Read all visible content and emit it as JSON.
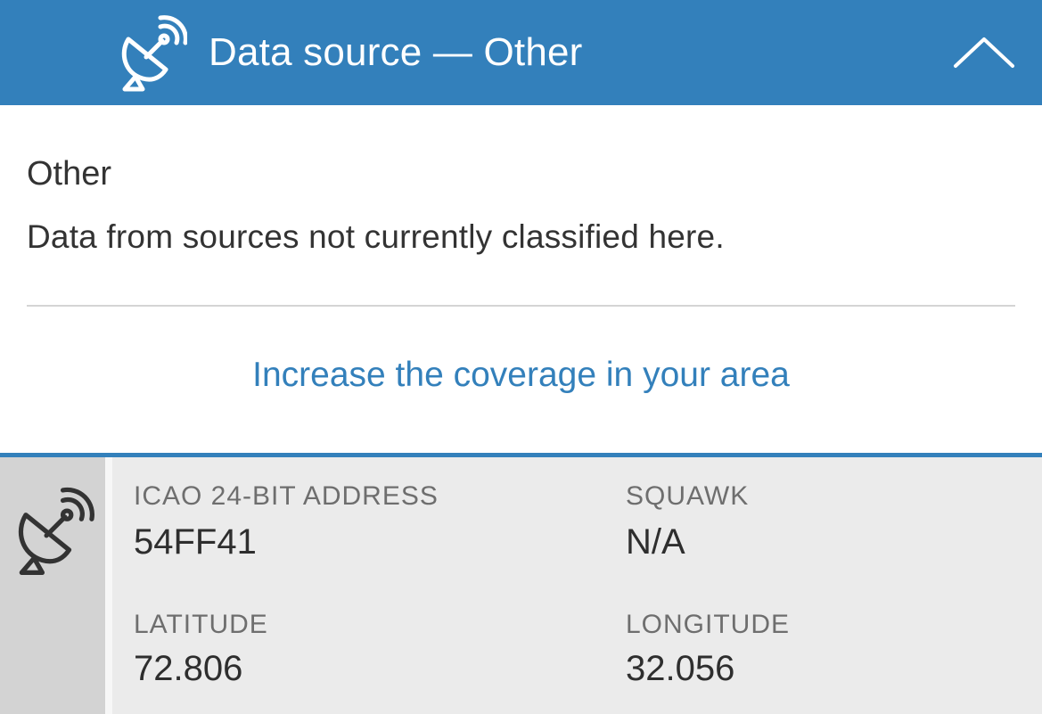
{
  "header": {
    "title": "Data source — Other",
    "icon": "satellite-dish-icon",
    "collapse_icon": "chevron-up-icon",
    "background_color": "#3380bb"
  },
  "source": {
    "name": "Other",
    "description": "Data from sources not currently classified here."
  },
  "coverage_link": {
    "label": "Increase the coverage in your area",
    "color": "#3380bb"
  },
  "info": {
    "icon": "satellite-dish-icon",
    "fields": [
      {
        "label": "ICAO 24-BIT ADDRESS",
        "value": "54FF41"
      },
      {
        "label": "SQUAWK",
        "value": "N/A"
      },
      {
        "label": "LATITUDE",
        "value": "72.806"
      },
      {
        "label": "LONGITUDE",
        "value": "32.056"
      }
    ]
  }
}
